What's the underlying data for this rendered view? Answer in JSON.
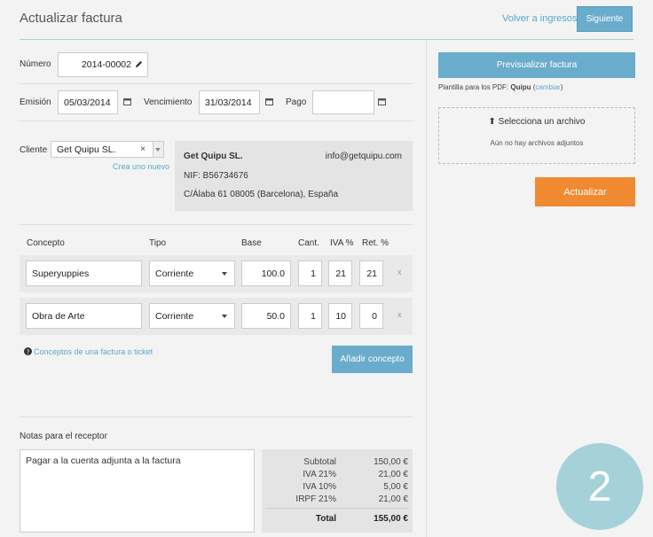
{
  "header": {
    "title": "Actualizar factura",
    "back_link": "Volver a ingresos",
    "next_button": "Siguiente"
  },
  "invoice": {
    "number_label": "Número",
    "number_value": "2014-00002",
    "issue_label": "Emisión",
    "issue_value": "05/03/2014",
    "due_label": "Vencimiento",
    "due_value": "31/03/2014",
    "payment_label": "Pago",
    "payment_value": ""
  },
  "client": {
    "label": "Cliente",
    "selected": "Get Quipu SL.",
    "new_link": "Crea uno nuevo",
    "card_name": "Get Quipu SL.",
    "card_email": "info@getquipu.com",
    "card_nif": "NIF: B56734676",
    "card_address": "C/Álaba 61 08005 (Barcelona), España"
  },
  "concepts": {
    "columns": {
      "concept": "Concepto",
      "type": "Tipo",
      "base": "Base",
      "qty": "Cant.",
      "vat": "IVA %",
      "ret": "Ret. %"
    },
    "rows": [
      {
        "concept": "Superyuppies",
        "type": "Corriente",
        "base": "100.0",
        "qty": "1",
        "vat": "21",
        "ret": "21",
        "delete": "x"
      },
      {
        "concept": "Obra de Arte",
        "type": "Corriente",
        "base": "50.0",
        "qty": "1",
        "vat": "10",
        "ret": "0",
        "delete": "x"
      }
    ],
    "help_link": "Conceptos de una factura o ticket",
    "add_button": "Añadir concepto"
  },
  "notes": {
    "label": "Notas para el receptor",
    "value": "Pagar a la cuenta adjunta a la factura"
  },
  "totals": [
    {
      "label": "Subtotal",
      "value": "150,00 €"
    },
    {
      "label": "IVA 21%",
      "value": "21,00 €"
    },
    {
      "label": "IVA 10%",
      "value": "5,00 €"
    },
    {
      "label": "IRPF 21%",
      "value": "21,00 €"
    },
    {
      "label": "Total",
      "value": "155,00 €"
    }
  ],
  "sidebar": {
    "preview_button": "Previsualizar factura",
    "template_prefix": "Plantilla para los PDF:",
    "template_name": "Quipu",
    "template_change": "cambiar",
    "upload_label": "Selecciona un archivo",
    "upload_empty": "Aún no hay archivos adjuntos",
    "update_button": "Actualizar"
  },
  "step_badge": "2",
  "colors": {
    "accent": "#6aaccb",
    "orange": "#f08a30",
    "badge": "#a5d2d9"
  }
}
